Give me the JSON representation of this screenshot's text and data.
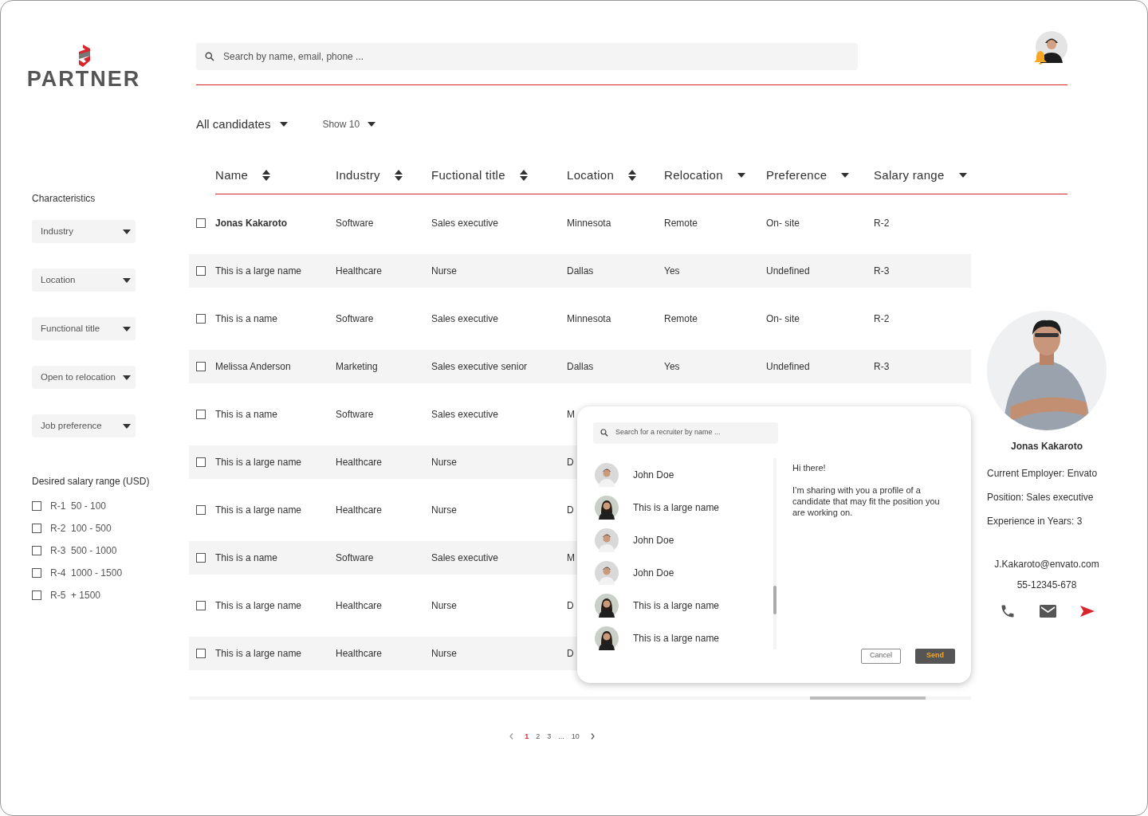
{
  "logo": {
    "wordmark": "PARTNER"
  },
  "search": {
    "placeholder": "Search by name, email, phone ..."
  },
  "filters": {
    "view": "All candidates",
    "page_size": "Show 10"
  },
  "sidebar": {
    "title": "Characteristics",
    "dropdowns": [
      "Industry",
      "Location",
      "Functional title",
      "Open to relocation",
      "Job preference"
    ],
    "salary": {
      "title": "Desired salary range (USD)",
      "options": [
        {
          "code": "R-1",
          "range": "50 - 100",
          "checked": false
        },
        {
          "code": "R-2",
          "range": "100 - 500",
          "checked": false
        },
        {
          "code": "R-3",
          "range": "500 - 1000",
          "checked": false
        },
        {
          "code": "R-4",
          "range": "1000 - 1500",
          "checked": false
        },
        {
          "code": "R-5",
          "range": "+ 1500",
          "checked": false
        }
      ]
    }
  },
  "table": {
    "columns": [
      {
        "label": "Name",
        "kind": "sortable"
      },
      {
        "label": "Industry",
        "kind": "sortable"
      },
      {
        "label": "Fuctional title",
        "kind": "sortable"
      },
      {
        "label": "Location",
        "kind": "sortable"
      },
      {
        "label": "Relocation",
        "kind": "dropdown"
      },
      {
        "label": "Preference",
        "kind": "dropdown"
      },
      {
        "label": "Salary range",
        "kind": "dropdown"
      }
    ],
    "rows": [
      {
        "selected": true,
        "checked": false,
        "cells": [
          "Jonas Kakaroto",
          "Software",
          "Sales executive",
          "Minnesota",
          "Remote",
          "On- site",
          "R-2"
        ]
      },
      {
        "selected": false,
        "checked": false,
        "cells": [
          "This is a large name",
          "Healthcare",
          "Nurse",
          "Dallas",
          "Yes",
          "Undefined",
          "R-3"
        ]
      },
      {
        "selected": false,
        "checked": false,
        "cells": [
          "This is a name",
          "Software",
          "Sales executive",
          "Minnesota",
          "Remote",
          "On- site",
          "R-2"
        ]
      },
      {
        "selected": false,
        "checked": false,
        "cells": [
          "Melissa Anderson",
          "Marketing",
          "Sales executive senior",
          "Dallas",
          "Yes",
          "Undefined",
          "R-3"
        ]
      },
      {
        "selected": false,
        "checked": false,
        "cells": [
          "This is a name",
          "Software",
          "Sales executive",
          "M"
        ]
      },
      {
        "selected": false,
        "checked": false,
        "cells": [
          "This is a large name",
          "Healthcare",
          "Nurse",
          "D"
        ]
      },
      {
        "selected": false,
        "checked": false,
        "cells": [
          "This is a large name",
          "Healthcare",
          "Nurse",
          "D"
        ]
      },
      {
        "selected": false,
        "checked": false,
        "cells": [
          "This is a name",
          "Software",
          "Sales executive",
          "M"
        ]
      },
      {
        "selected": false,
        "checked": false,
        "cells": [
          "This is a large name",
          "Healthcare",
          "Nurse",
          "D"
        ]
      },
      {
        "selected": false,
        "checked": false,
        "cells": [
          "This is a large name",
          "Healthcare",
          "Nurse",
          "D"
        ]
      }
    ]
  },
  "share_dialog": {
    "search_placeholder": "Search for a recruiter by name ...",
    "recruiters": [
      {
        "name": "John Doe",
        "kind": "man"
      },
      {
        "name": "This is a large name",
        "kind": "woman"
      },
      {
        "name": "John Doe",
        "kind": "man"
      },
      {
        "name": "John Doe",
        "kind": "man"
      },
      {
        "name": "This is a large name",
        "kind": "woman"
      },
      {
        "name": "This is a large name",
        "kind": "woman"
      }
    ],
    "message": [
      "Hi there!",
      "I’m sharing with you a profile of a candidate that may fit the position you are working on."
    ],
    "buttons": [
      {
        "label": "Cancel",
        "kind": "secondary"
      },
      {
        "label": "Send",
        "kind": "primary"
      }
    ]
  },
  "profile": {
    "name": "Jonas Kakaroto",
    "details": [
      "Current Employer: Envato",
      "Position: Sales executive",
      "Experience in Years: 3"
    ],
    "email": "J.Kakaroto@envato.com",
    "phone": "55-12345-678"
  },
  "pagination": {
    "pages": [
      {
        "label": "1",
        "selected": true
      },
      {
        "label": "2",
        "selected": false
      },
      {
        "label": "3",
        "selected": false
      },
      {
        "label": "...",
        "selected": false
      },
      {
        "label": "10",
        "selected": false
      }
    ]
  }
}
